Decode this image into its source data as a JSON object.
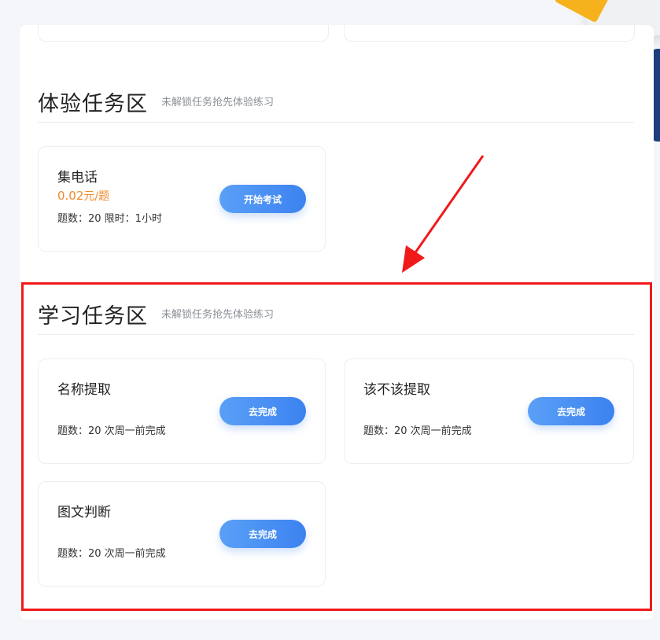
{
  "experience": {
    "title": "体验任务区",
    "subtitle": "未解锁任务抢先体验练习",
    "tasks": [
      {
        "name": "集电话",
        "price_value": "0.02",
        "price_unit": "元/题",
        "meta": "题数：20 限时：1小时",
        "button": "开始考试"
      }
    ]
  },
  "study": {
    "title": "学习任务区",
    "subtitle": "未解锁任务抢先体验练习",
    "tasks": [
      {
        "name": "名称提取",
        "meta": "题数：20 次周一前完成",
        "button": "去完成"
      },
      {
        "name": "该不该提取",
        "meta": "题数：20 次周一前完成",
        "button": "去完成"
      },
      {
        "name": "图文判断",
        "meta": "题数：20 次周一前完成",
        "button": "去完成"
      }
    ]
  },
  "colors": {
    "accent": "#3c82f0",
    "price": "#f08a2c",
    "highlight": "#f11a1a"
  }
}
